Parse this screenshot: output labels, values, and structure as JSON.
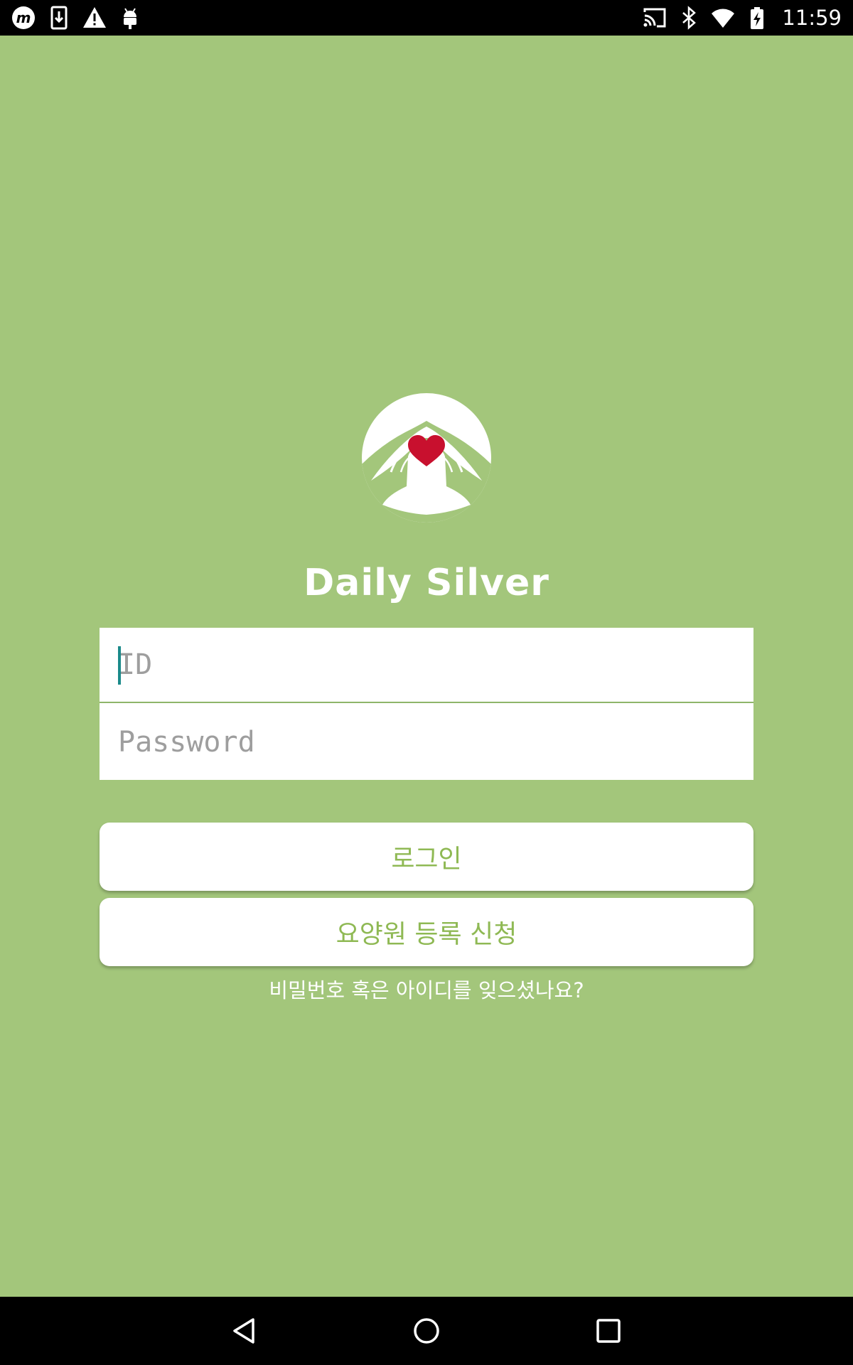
{
  "status_bar": {
    "time": "11:59",
    "left_icons": [
      "app-m-icon",
      "download-icon",
      "warning-icon",
      "android-icon"
    ],
    "right_icons": [
      "cast-icon",
      "bluetooth-icon",
      "wifi-icon",
      "battery-charging-icon"
    ]
  },
  "app": {
    "brand_name": "Daily Silver",
    "logo_icon": "heart-hands-logo-icon",
    "accent_color": "#8fb954",
    "background_color": "#a3c67b",
    "heart_color": "#c8102e"
  },
  "form": {
    "id_placeholder": "ID",
    "password_placeholder": "Password",
    "id_value": "",
    "password_value": ""
  },
  "buttons": {
    "login_label": "로그인",
    "register_label": "요양원 등록 신청"
  },
  "links": {
    "forgot_label": "비밀번호 혹은 아이디를 잊으셨나요?"
  },
  "nav_bar": {
    "icons": [
      "back-icon",
      "home-icon",
      "recents-icon"
    ]
  }
}
